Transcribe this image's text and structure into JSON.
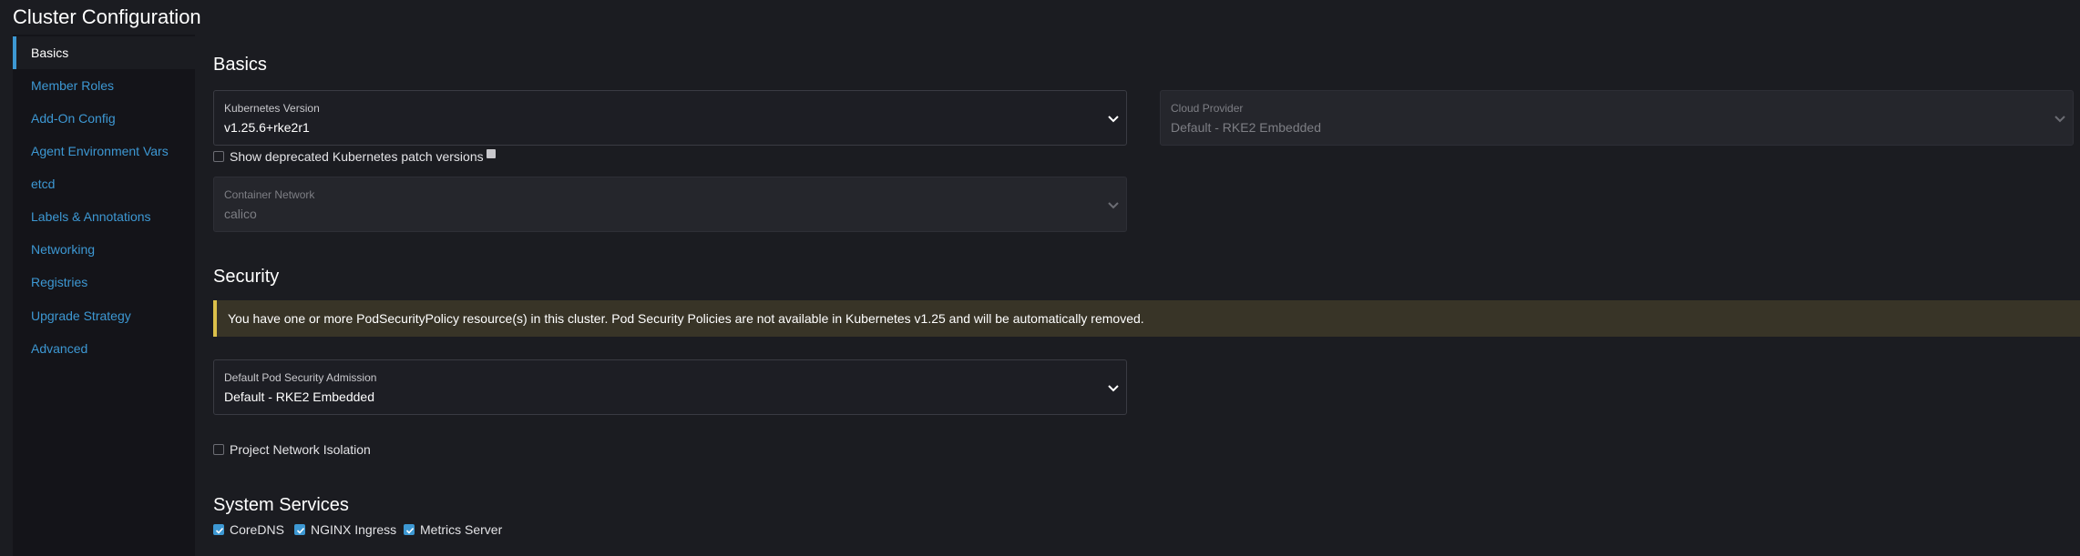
{
  "page": {
    "title": "Cluster Configuration"
  },
  "sidebar": {
    "items": [
      {
        "label": "Basics"
      },
      {
        "label": "Member Roles"
      },
      {
        "label": "Add-On Config"
      },
      {
        "label": "Agent Environment Vars"
      },
      {
        "label": "etcd"
      },
      {
        "label": "Labels & Annotations"
      },
      {
        "label": "Networking"
      },
      {
        "label": "Registries"
      },
      {
        "label": "Upgrade Strategy"
      },
      {
        "label": "Advanced"
      }
    ]
  },
  "basics": {
    "title": "Basics",
    "kubernetes_version": {
      "label": "Kubernetes Version",
      "value": "v1.25.6+rke2r1"
    },
    "cloud_provider": {
      "label": "Cloud Provider",
      "value": "Default - RKE2 Embedded"
    },
    "show_deprecated": {
      "label": "Show deprecated Kubernetes patch versions",
      "checked": false
    },
    "container_network": {
      "label": "Container Network",
      "value": "calico"
    }
  },
  "security": {
    "title": "Security",
    "banner": "You have one or more PodSecurityPolicy resource(s) in this cluster. Pod Security Policies are not available in Kubernetes v1.25 and will be automatically removed.",
    "psa": {
      "label": "Default Pod Security Admission",
      "value": "Default - RKE2 Embedded"
    },
    "project_isolation": {
      "label": "Project Network Isolation",
      "checked": false
    }
  },
  "system_services": {
    "title": "System Services",
    "items": [
      {
        "label": "CoreDNS",
        "checked": true
      },
      {
        "label": "NGINX Ingress",
        "checked": true
      },
      {
        "label": "Metrics Server",
        "checked": true
      }
    ]
  },
  "colors": {
    "accent": "#3d98d3",
    "background": "#1b1c21",
    "sidebar": "#141419",
    "warning": "#dbc04a"
  },
  "icons": {
    "chevron": "chevron-down-icon",
    "check": "check-icon",
    "info": "info-icon"
  }
}
